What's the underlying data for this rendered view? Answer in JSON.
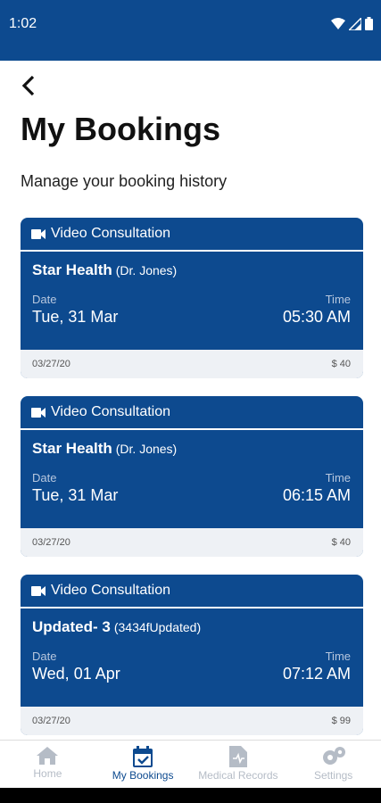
{
  "status": {
    "time": "1:02"
  },
  "header": {
    "title": "My Bookings",
    "subtitle": "Manage your booking history"
  },
  "labels": {
    "date": "Date",
    "time": "Time"
  },
  "bookings": [
    {
      "type": "Video Consultation",
      "name": "Star Health",
      "sub": "(Dr. Jones)",
      "date": "Tue, 31 Mar",
      "time": "05:30 AM",
      "created": "03/27/20",
      "price": "$ 40"
    },
    {
      "type": "Video Consultation",
      "name": "Star Health",
      "sub": "(Dr. Jones)",
      "date": "Tue, 31 Mar",
      "time": "06:15 AM",
      "created": "03/27/20",
      "price": "$ 40"
    },
    {
      "type": "Video Consultation",
      "name": "Updated- 3",
      "sub": "(3434fUpdated)",
      "date": "Wed, 01 Apr",
      "time": "07:12 AM",
      "created": "03/27/20",
      "price": "$ 99"
    }
  ],
  "nav": [
    {
      "label": "Home",
      "icon": "home-icon",
      "active": false
    },
    {
      "label": "My Bookings",
      "icon": "calendar-check-icon",
      "active": true
    },
    {
      "label": "Medical Records",
      "icon": "document-icon",
      "active": false
    },
    {
      "label": "Settings",
      "icon": "gear-icon",
      "active": false
    }
  ],
  "colors": {
    "primary": "#0d4a8f",
    "inactive": "#b5bcc6"
  }
}
